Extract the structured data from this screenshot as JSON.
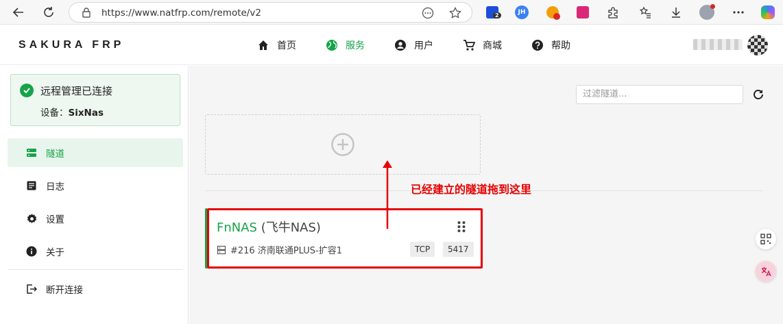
{
  "browser": {
    "url": "https://www.natfrp.com/remote/v2",
    "ext_badge": "2",
    "ext_jh": "JH"
  },
  "app": {
    "brand": "SAKURA FRP",
    "nav": [
      {
        "label": "首页",
        "icon": "home-icon"
      },
      {
        "label": "服务",
        "icon": "globe-icon"
      },
      {
        "label": "用户",
        "icon": "account-icon"
      },
      {
        "label": "商城",
        "icon": "cart-icon"
      },
      {
        "label": "帮助",
        "icon": "help-icon"
      }
    ],
    "active_nav": "服务",
    "accent_color": "#16a34a"
  },
  "sidebar": {
    "status_title": "远程管理已连接",
    "device_label": "设备：",
    "device_name": "SixNas",
    "items": [
      {
        "label": "隧道",
        "icon": "tunnel-icon"
      },
      {
        "label": "日志",
        "icon": "log-icon"
      },
      {
        "label": "设置",
        "icon": "settings-icon"
      },
      {
        "label": "关于",
        "icon": "info-icon"
      }
    ],
    "disconnect_label": "断开连接"
  },
  "main": {
    "filter_placeholder": "过滤隧道...",
    "tunnel": {
      "name": "FnNAS",
      "alias": " (飞牛NAS)",
      "node": "#216 济南联通PLUS-扩容1",
      "protocol": "TCP",
      "port": "5417"
    }
  },
  "annotation": {
    "text": "已经建立的隧道拖到这里",
    "color": "#e60000"
  }
}
